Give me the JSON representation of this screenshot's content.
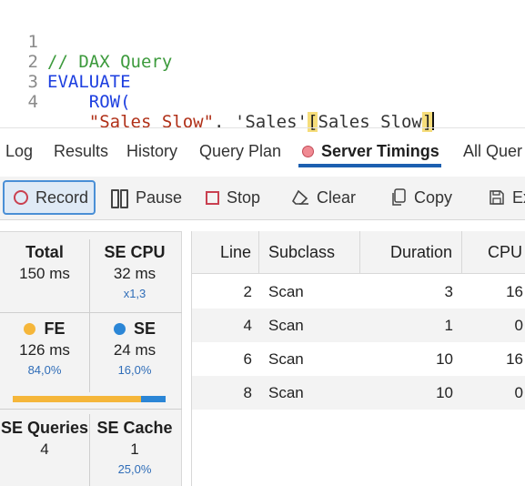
{
  "editor": {
    "lines": [
      {
        "n": "1",
        "comment": "// DAX Query"
      },
      {
        "n": "2",
        "kw": "EVALUATE"
      },
      {
        "n": "3",
        "indent": "    ",
        "fn": "ROW("
      },
      {
        "n": "4",
        "indent": "    ",
        "str": "\"Sales Slow\"",
        "sep": ". 'Sales'",
        "b1": "[",
        "col": "Sales Slow",
        "b2": "]"
      }
    ]
  },
  "tabs": [
    "Log",
    "Results",
    "History",
    "Query Plan",
    "Server Timings",
    "All Quer"
  ],
  "active_tab": "Server Timings",
  "toolbar": {
    "record": "Record",
    "pause": "Pause",
    "stop": "Stop",
    "clear": "Clear",
    "copy": "Copy",
    "export": "Ex"
  },
  "metrics": {
    "total": {
      "label": "Total",
      "value": "150 ms"
    },
    "se_cpu": {
      "label": "SE CPU",
      "value": "32 ms",
      "sub": "x1,3"
    },
    "fe": {
      "label": "FE",
      "value": "126 ms",
      "pct": "84,0%"
    },
    "se": {
      "label": "SE",
      "value": "24 ms",
      "pct": "16,0%"
    },
    "se_queries": {
      "label": "SE Queries",
      "value": "4"
    },
    "se_cache": {
      "label": "SE Cache",
      "value": "1",
      "pct": "25,0%"
    },
    "fe_fraction": 0.84,
    "colors": {
      "fe": "#f5b63a",
      "se": "#2b86d6"
    }
  },
  "table": {
    "headers": [
      "Line",
      "Subclass",
      "Duration",
      "CPU"
    ],
    "rows": [
      {
        "line": "2",
        "subclass": "Scan",
        "duration": "3",
        "cpu": "16"
      },
      {
        "line": "4",
        "subclass": "Scan",
        "duration": "1",
        "cpu": "0"
      },
      {
        "line": "6",
        "subclass": "Scan",
        "duration": "10",
        "cpu": "16"
      },
      {
        "line": "8",
        "subclass": "Scan",
        "duration": "10",
        "cpu": "0"
      }
    ]
  }
}
